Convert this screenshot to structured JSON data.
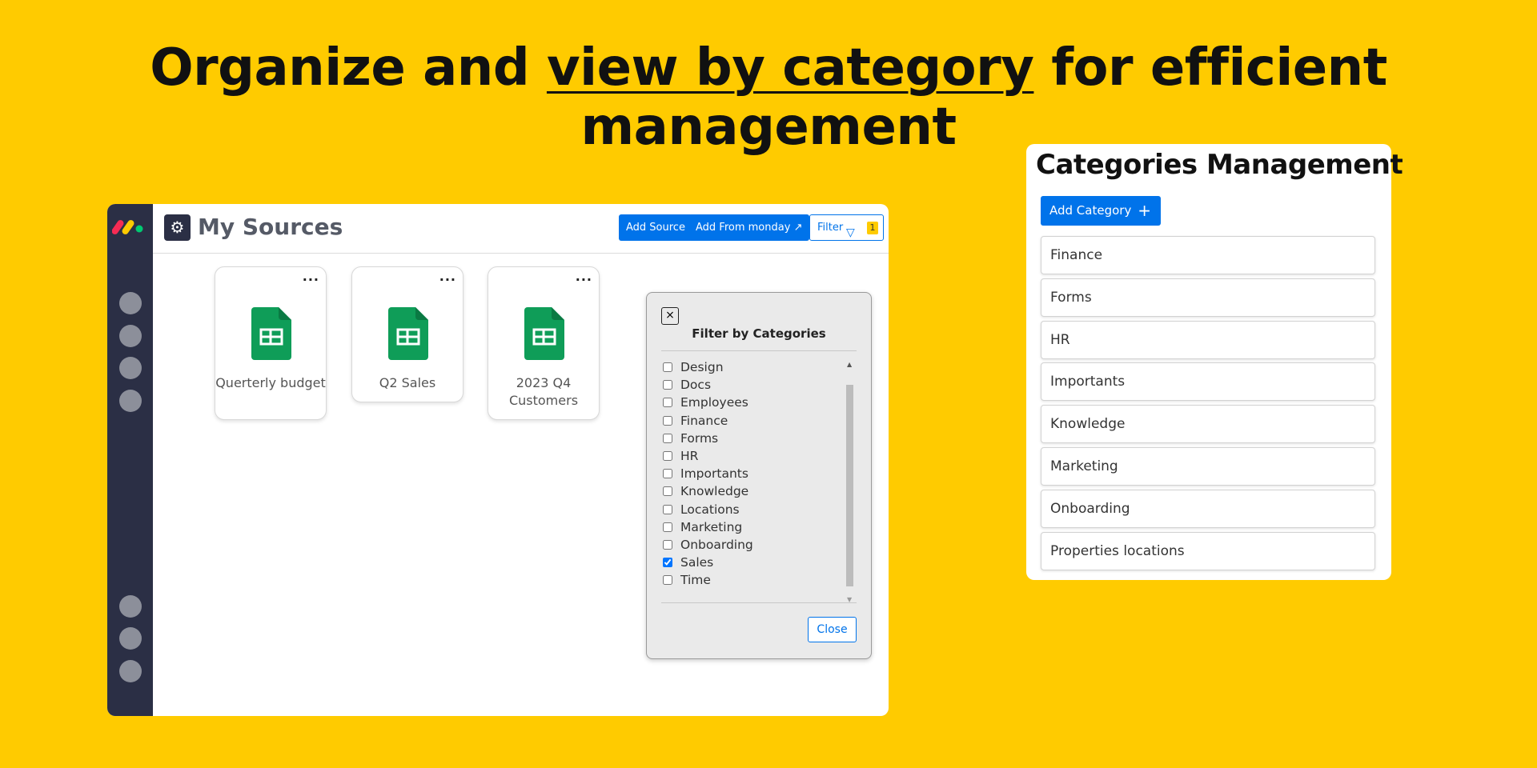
{
  "headline": {
    "before": "Organize and ",
    "highlight": "view by category",
    "after": " for efficient management"
  },
  "app": {
    "title": "My Sources",
    "add_source_label": "Add Source",
    "add_from_monday_label": "Add From monday",
    "filter_label": "Filter",
    "filter_count": "1",
    "sources": [
      {
        "name": "Querterly budget"
      },
      {
        "name": "Q2 Sales"
      },
      {
        "name": "2023 Q4 Customers"
      }
    ],
    "more_label": "..."
  },
  "filter_dialog": {
    "title": "Filter by Categories",
    "categories": [
      {
        "label": "Design",
        "checked": false
      },
      {
        "label": "Docs",
        "checked": false
      },
      {
        "label": "Employees",
        "checked": false
      },
      {
        "label": "Finance",
        "checked": false
      },
      {
        "label": "Forms",
        "checked": false
      },
      {
        "label": "HR",
        "checked": false
      },
      {
        "label": "Importants",
        "checked": false
      },
      {
        "label": "Knowledge",
        "checked": false
      },
      {
        "label": "Locations",
        "checked": false
      },
      {
        "label": "Marketing",
        "checked": false
      },
      {
        "label": "Onboarding",
        "checked": false
      },
      {
        "label": "Sales",
        "checked": true
      },
      {
        "label": "Time",
        "checked": false
      }
    ],
    "close_label": "Close"
  },
  "categories_management": {
    "title": "Categories Management",
    "add_label": "Add Category",
    "items": [
      "Finance",
      "Forms",
      "HR",
      "Importants",
      "Knowledge",
      "Marketing",
      "Onboarding",
      "Properties locations"
    ]
  },
  "colors": {
    "background": "#ffcb00",
    "primary": "#0073ea",
    "rail": "#2b2f45",
    "sheets_green": "#0f9d58"
  }
}
